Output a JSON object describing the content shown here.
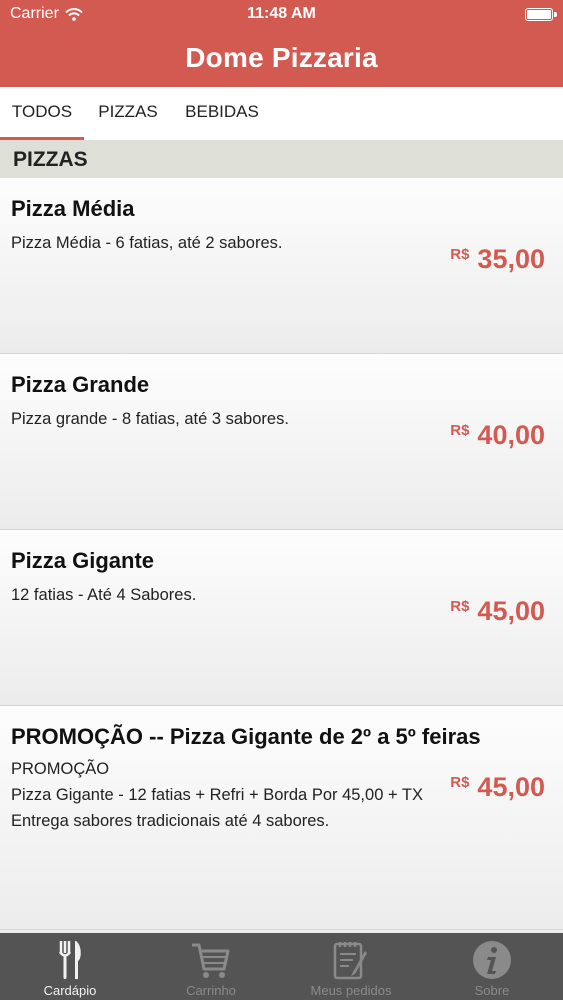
{
  "status_bar": {
    "carrier": "Carrier",
    "time": "11:48 AM"
  },
  "header": {
    "title": "Dome Pizzaria",
    "color": "#d35a50"
  },
  "tabs": [
    {
      "label": "TODOS",
      "active": true
    },
    {
      "label": "PIZZAS",
      "active": false
    },
    {
      "label": "BEBIDAS",
      "active": false
    }
  ],
  "section": {
    "title": "PIZZAS"
  },
  "items": [
    {
      "name": "Pizza Média",
      "description": "Pizza Média - 6 fatias, até 2 sabores.",
      "currency": "R$",
      "price": "35,00"
    },
    {
      "name": "Pizza Grande",
      "description": "Pizza grande - 8 fatias, até 3 sabores.",
      "currency": "R$",
      "price": "40,00"
    },
    {
      "name": "Pizza Gigante",
      "description": "12 fatias - Até 4 Sabores.",
      "currency": "R$",
      "price": "45,00"
    },
    {
      "name": "PROMOÇÃO  -- Pizza Gigante de 2º a 5º feiras",
      "description": "                    PROMOÇÃO\nPizza Gigante - 12 fatias + Refri + Borda Por 45,00 + TX Entrega sabores tradicionais até 4 sabores.",
      "currency": "R$",
      "price": "45,00"
    }
  ],
  "tabbar": [
    {
      "label": "Cardápio",
      "icon": "fork-knife-icon",
      "active": true
    },
    {
      "label": "Carrinho",
      "icon": "cart-icon",
      "active": false
    },
    {
      "label": "Meus pedidos",
      "icon": "order-list-icon",
      "active": false
    },
    {
      "label": "Sobre",
      "icon": "info-icon",
      "active": false
    }
  ]
}
